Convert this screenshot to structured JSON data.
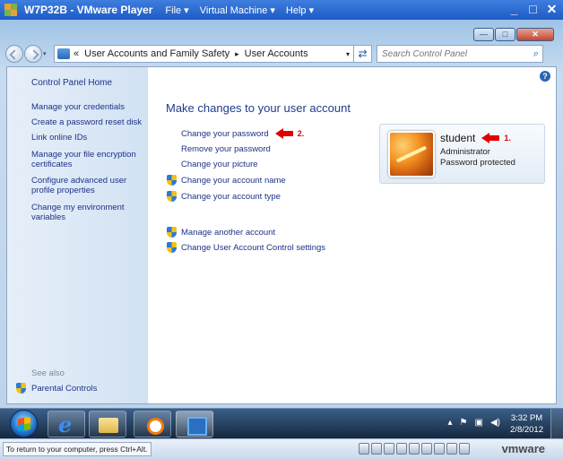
{
  "vmware": {
    "title": "W7P32B - VMware Player",
    "menus": [
      "File ▾",
      "Virtual Machine ▾",
      "Help ▾"
    ],
    "controls": [
      "_",
      "□",
      "✕"
    ]
  },
  "explorer": {
    "caption_buttons": {
      "min": "—",
      "max": "□",
      "close": "✕"
    },
    "breadcrumb": {
      "overflow": "«",
      "parent": "User Accounts and Family Safety",
      "separator": "▸",
      "current": "User Accounts",
      "dropdown": "▾"
    },
    "refresh_glyph": "⇄",
    "search_placeholder": "Search Control Panel",
    "search_glyph": "⌕"
  },
  "left_pane": {
    "home": "Control Panel Home",
    "items": [
      "Manage your credentials",
      "Create a password reset disk",
      "Link online IDs",
      "Manage your file encryption certificates",
      "Configure advanced user profile properties",
      "Change my environment variables"
    ],
    "see_also": "See also",
    "parental": "Parental Controls"
  },
  "main": {
    "help_glyph": "?",
    "title": "Make changes to your user account",
    "links": [
      "Change your password",
      "Remove your password",
      "Change your picture",
      "Change your account name",
      "Change your account type"
    ],
    "links2": [
      "Manage another account",
      "Change User Account Control settings"
    ],
    "annotation_2": "2.",
    "annotation_1": "1."
  },
  "user": {
    "name": "student",
    "role": "Administrator",
    "status": "Password protected"
  },
  "taskbar": {
    "tray_caret": "▴",
    "tray_icons": [
      "⚑",
      "▣",
      "◀)"
    ],
    "time": "3:32 PM",
    "date": "2/8/2012"
  },
  "status_bar": {
    "message": "To return to your computer, press Ctrl+Alt.",
    "brand": "vmware"
  },
  "colors": {
    "link": "#1e3287",
    "title": "#1e3c8a",
    "annotation": "#e00000"
  }
}
